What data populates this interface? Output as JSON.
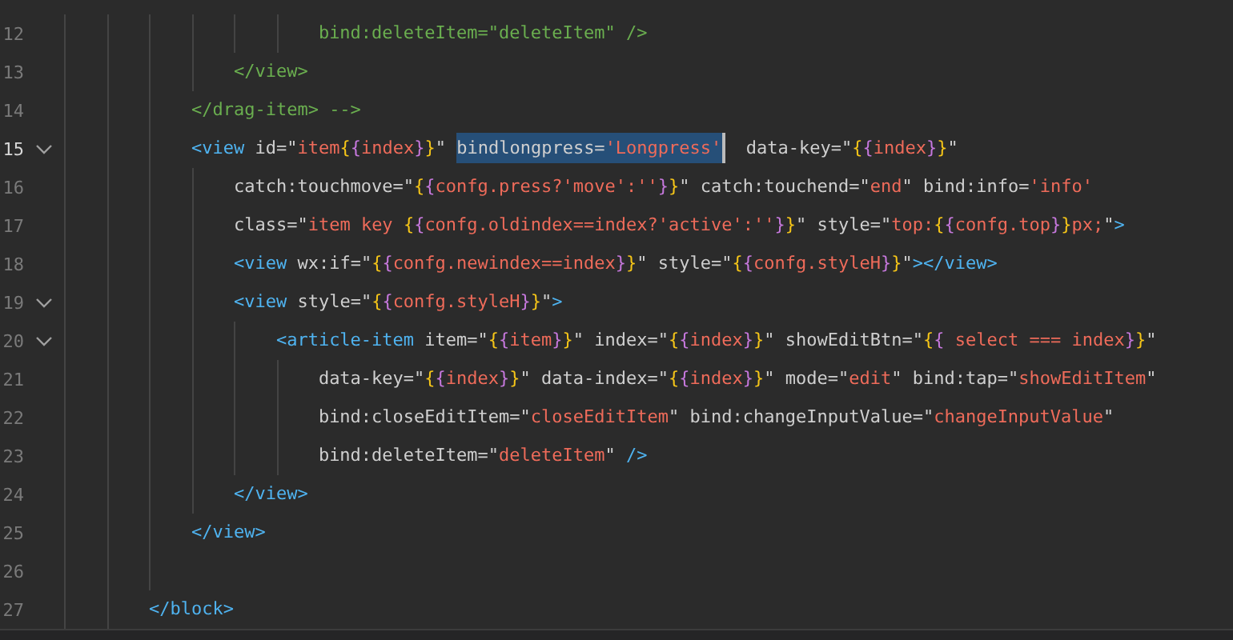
{
  "editor": {
    "lines": [
      {
        "number": "12",
        "current": false,
        "foldable": false,
        "tokens": [
          {
            "text": "                        bind:deleteItem=\"deleteItem\" />",
            "kind": "comment"
          }
        ]
      },
      {
        "number": "13",
        "current": false,
        "foldable": false,
        "tokens": [
          {
            "text": "                </view>",
            "kind": "comment"
          }
        ]
      },
      {
        "number": "14",
        "current": false,
        "foldable": false,
        "tokens": [
          {
            "text": "            </drag-item> -->",
            "kind": "comment"
          }
        ]
      },
      {
        "number": "15",
        "current": true,
        "foldable": true,
        "tokens": [
          {
            "text": "            <view",
            "kind": "tag"
          },
          {
            "text": " id=",
            "kind": "attr"
          },
          {
            "text": "\"",
            "kind": "quote"
          },
          {
            "text": "item",
            "kind": "string"
          },
          {
            "text": "{",
            "kind": "brace1"
          },
          {
            "text": "{",
            "kind": "brace2"
          },
          {
            "text": "index",
            "kind": "string"
          },
          {
            "text": "}",
            "kind": "brace2"
          },
          {
            "text": "}",
            "kind": "brace1"
          },
          {
            "text": "\" ",
            "kind": "quote"
          },
          {
            "kind": "selection",
            "tokens": [
              {
                "text": "bindlongpress=",
                "kind": "attr"
              },
              {
                "text": "'Longpress'",
                "kind": "string"
              }
            ]
          },
          {
            "text": "  data-key=",
            "kind": "attr"
          },
          {
            "text": "\"",
            "kind": "quote"
          },
          {
            "text": "{",
            "kind": "brace1"
          },
          {
            "text": "{",
            "kind": "brace2"
          },
          {
            "text": "index",
            "kind": "string"
          },
          {
            "text": "}",
            "kind": "brace2"
          },
          {
            "text": "}",
            "kind": "brace1"
          },
          {
            "text": "\"",
            "kind": "quote"
          }
        ]
      },
      {
        "number": "16",
        "current": false,
        "foldable": false,
        "tokens": [
          {
            "text": "                catch:touchmove=",
            "kind": "attr"
          },
          {
            "text": "\"",
            "kind": "quote"
          },
          {
            "text": "{",
            "kind": "brace1"
          },
          {
            "text": "{",
            "kind": "brace2"
          },
          {
            "text": "confg.press?'move':''",
            "kind": "string"
          },
          {
            "text": "}",
            "kind": "brace2"
          },
          {
            "text": "}",
            "kind": "brace1"
          },
          {
            "text": "\"",
            "kind": "quote"
          },
          {
            "text": " catch:touchend=",
            "kind": "attr"
          },
          {
            "text": "\"",
            "kind": "quote"
          },
          {
            "text": "end",
            "kind": "string"
          },
          {
            "text": "\"",
            "kind": "quote"
          },
          {
            "text": " bind:info=",
            "kind": "attr"
          },
          {
            "text": "'info'",
            "kind": "string"
          }
        ]
      },
      {
        "number": "17",
        "current": false,
        "foldable": false,
        "tokens": [
          {
            "text": "                class=",
            "kind": "attr"
          },
          {
            "text": "\"",
            "kind": "quote"
          },
          {
            "text": "item key ",
            "kind": "string"
          },
          {
            "text": "{",
            "kind": "brace1"
          },
          {
            "text": "{",
            "kind": "brace2"
          },
          {
            "text": "confg.oldindex==index?'active':''",
            "kind": "string"
          },
          {
            "text": "}",
            "kind": "brace2"
          },
          {
            "text": "}",
            "kind": "brace1"
          },
          {
            "text": "\"",
            "kind": "quote"
          },
          {
            "text": " style=",
            "kind": "attr"
          },
          {
            "text": "\"",
            "kind": "quote"
          },
          {
            "text": "top:",
            "kind": "string"
          },
          {
            "text": "{",
            "kind": "brace1"
          },
          {
            "text": "{",
            "kind": "brace2"
          },
          {
            "text": "confg.top",
            "kind": "string"
          },
          {
            "text": "}",
            "kind": "brace2"
          },
          {
            "text": "}",
            "kind": "brace1"
          },
          {
            "text": "px;",
            "kind": "string"
          },
          {
            "text": "\"",
            "kind": "quote"
          },
          {
            "text": ">",
            "kind": "tag"
          }
        ]
      },
      {
        "number": "18",
        "current": false,
        "foldable": false,
        "tokens": [
          {
            "text": "                <view",
            "kind": "tag"
          },
          {
            "text": " wx:if=",
            "kind": "attr"
          },
          {
            "text": "\"",
            "kind": "quote"
          },
          {
            "text": "{",
            "kind": "brace1"
          },
          {
            "text": "{",
            "kind": "brace2"
          },
          {
            "text": "confg.newindex==index",
            "kind": "string"
          },
          {
            "text": "}",
            "kind": "brace2"
          },
          {
            "text": "}",
            "kind": "brace1"
          },
          {
            "text": "\"",
            "kind": "quote"
          },
          {
            "text": " style=",
            "kind": "attr"
          },
          {
            "text": "\"",
            "kind": "quote"
          },
          {
            "text": "{",
            "kind": "brace1"
          },
          {
            "text": "{",
            "kind": "brace2"
          },
          {
            "text": "confg.styleH",
            "kind": "string"
          },
          {
            "text": "}",
            "kind": "brace2"
          },
          {
            "text": "}",
            "kind": "brace1"
          },
          {
            "text": "\"",
            "kind": "quote"
          },
          {
            "text": "></view>",
            "kind": "tag"
          }
        ]
      },
      {
        "number": "19",
        "current": false,
        "foldable": true,
        "tokens": [
          {
            "text": "                <view",
            "kind": "tag"
          },
          {
            "text": " style=",
            "kind": "attr"
          },
          {
            "text": "\"",
            "kind": "quote"
          },
          {
            "text": "{",
            "kind": "brace1"
          },
          {
            "text": "{",
            "kind": "brace2"
          },
          {
            "text": "confg.styleH",
            "kind": "string"
          },
          {
            "text": "}",
            "kind": "brace2"
          },
          {
            "text": "}",
            "kind": "brace1"
          },
          {
            "text": "\"",
            "kind": "quote"
          },
          {
            "text": ">",
            "kind": "tag"
          }
        ]
      },
      {
        "number": "20",
        "current": false,
        "foldable": true,
        "tokens": [
          {
            "text": "                    <article-item",
            "kind": "tag"
          },
          {
            "text": " item=",
            "kind": "attr"
          },
          {
            "text": "\"",
            "kind": "quote"
          },
          {
            "text": "{",
            "kind": "brace1"
          },
          {
            "text": "{",
            "kind": "brace2"
          },
          {
            "text": "item",
            "kind": "string"
          },
          {
            "text": "}",
            "kind": "brace2"
          },
          {
            "text": "}",
            "kind": "brace1"
          },
          {
            "text": "\"",
            "kind": "quote"
          },
          {
            "text": " index=",
            "kind": "attr"
          },
          {
            "text": "\"",
            "kind": "quote"
          },
          {
            "text": "{",
            "kind": "brace1"
          },
          {
            "text": "{",
            "kind": "brace2"
          },
          {
            "text": "index",
            "kind": "string"
          },
          {
            "text": "}",
            "kind": "brace2"
          },
          {
            "text": "}",
            "kind": "brace1"
          },
          {
            "text": "\"",
            "kind": "quote"
          },
          {
            "text": " showEditBtn=",
            "kind": "attr"
          },
          {
            "text": "\"",
            "kind": "quote"
          },
          {
            "text": "{",
            "kind": "brace1"
          },
          {
            "text": "{",
            "kind": "brace2"
          },
          {
            "text": " select === index",
            "kind": "string"
          },
          {
            "text": "}",
            "kind": "brace2"
          },
          {
            "text": "}",
            "kind": "brace1"
          },
          {
            "text": "\"",
            "kind": "quote"
          }
        ]
      },
      {
        "number": "21",
        "current": false,
        "foldable": false,
        "tokens": [
          {
            "text": "                        data-key=",
            "kind": "attr"
          },
          {
            "text": "\"",
            "kind": "quote"
          },
          {
            "text": "{",
            "kind": "brace1"
          },
          {
            "text": "{",
            "kind": "brace2"
          },
          {
            "text": "index",
            "kind": "string"
          },
          {
            "text": "}",
            "kind": "brace2"
          },
          {
            "text": "}",
            "kind": "brace1"
          },
          {
            "text": "\"",
            "kind": "quote"
          },
          {
            "text": " data-index=",
            "kind": "attr"
          },
          {
            "text": "\"",
            "kind": "quote"
          },
          {
            "text": "{",
            "kind": "brace1"
          },
          {
            "text": "{",
            "kind": "brace2"
          },
          {
            "text": "index",
            "kind": "string"
          },
          {
            "text": "}",
            "kind": "brace2"
          },
          {
            "text": "}",
            "kind": "brace1"
          },
          {
            "text": "\"",
            "kind": "quote"
          },
          {
            "text": " mode=",
            "kind": "attr"
          },
          {
            "text": "\"",
            "kind": "quote"
          },
          {
            "text": "edit",
            "kind": "string"
          },
          {
            "text": "\"",
            "kind": "quote"
          },
          {
            "text": " bind:tap=",
            "kind": "attr"
          },
          {
            "text": "\"",
            "kind": "quote"
          },
          {
            "text": "showEditItem",
            "kind": "string"
          },
          {
            "text": "\"",
            "kind": "quote"
          }
        ]
      },
      {
        "number": "22",
        "current": false,
        "foldable": false,
        "tokens": [
          {
            "text": "                        bind:closeEditItem=",
            "kind": "attr"
          },
          {
            "text": "\"",
            "kind": "quote"
          },
          {
            "text": "closeEditItem",
            "kind": "string"
          },
          {
            "text": "\"",
            "kind": "quote"
          },
          {
            "text": " bind:changeInputValue=",
            "kind": "attr"
          },
          {
            "text": "\"",
            "kind": "quote"
          },
          {
            "text": "changeInputValue",
            "kind": "string"
          },
          {
            "text": "\"",
            "kind": "quote"
          }
        ]
      },
      {
        "number": "23",
        "current": false,
        "foldable": false,
        "tokens": [
          {
            "text": "                        bind:deleteItem=",
            "kind": "attr"
          },
          {
            "text": "\"",
            "kind": "quote"
          },
          {
            "text": "deleteItem",
            "kind": "string"
          },
          {
            "text": "\" ",
            "kind": "quote"
          },
          {
            "text": "/>",
            "kind": "tag"
          }
        ]
      },
      {
        "number": "24",
        "current": false,
        "foldable": false,
        "tokens": [
          {
            "text": "                </view>",
            "kind": "tag"
          }
        ]
      },
      {
        "number": "25",
        "current": false,
        "foldable": false,
        "tokens": [
          {
            "text": "            </view>",
            "kind": "tag"
          }
        ]
      },
      {
        "number": "26",
        "current": false,
        "foldable": false
      },
      {
        "number": "27",
        "current": false,
        "foldable": false,
        "tokens": [
          {
            "text": "        </block>",
            "kind": "tag"
          }
        ]
      }
    ]
  }
}
